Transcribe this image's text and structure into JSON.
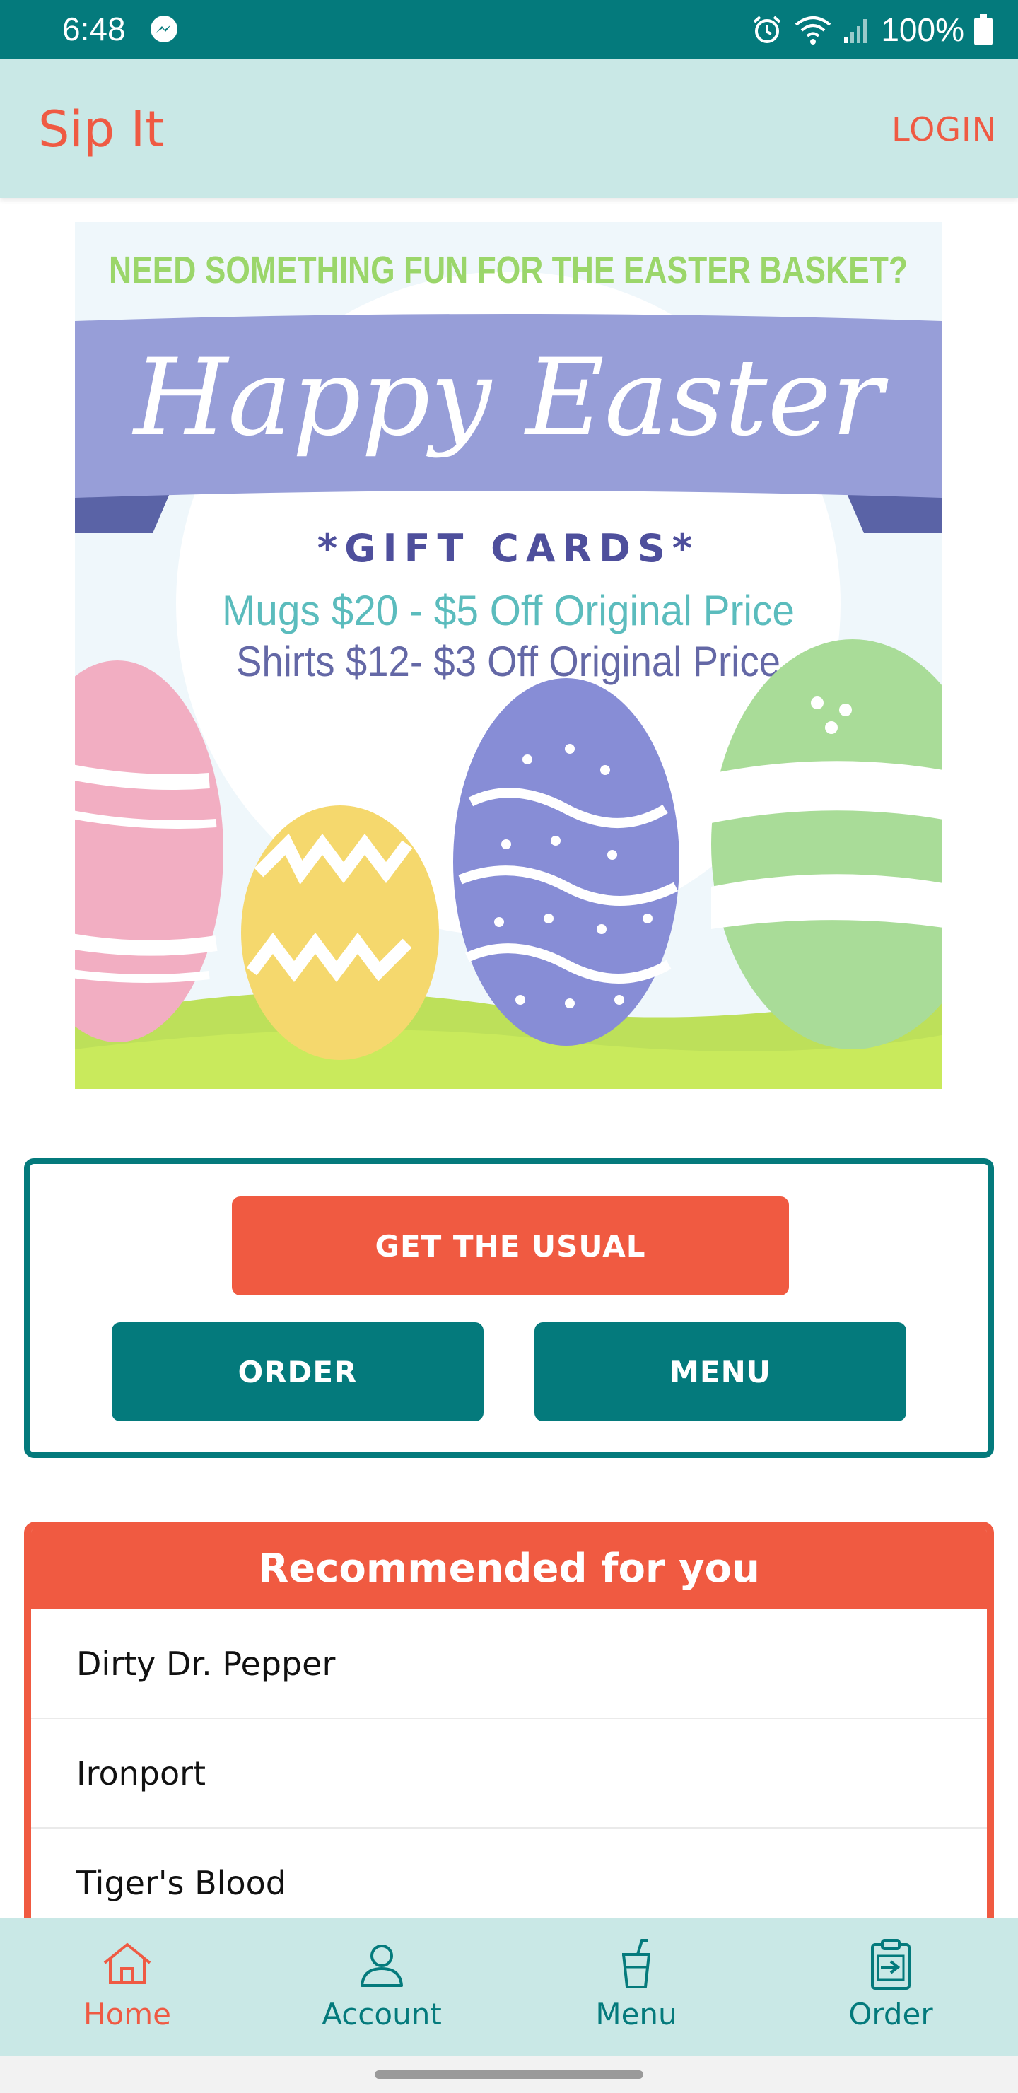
{
  "status_bar": {
    "time": "6:48",
    "battery": "100%"
  },
  "app_bar": {
    "title": "Sip It",
    "login": "LOGIN"
  },
  "banner": {
    "headline": "NEED SOMETHING FUN FOR THE EASTER BASKET?",
    "script_title": "Happy Easter",
    "gift_cards": "*GIFT CARDS*",
    "line1": "Mugs $20 - $5 Off Original Price",
    "line2": "Shirts $12- $3 Off Original Price"
  },
  "actions": {
    "usual": "GET THE USUAL",
    "order": "ORDER",
    "menu": "MENU"
  },
  "recommended": {
    "title": "Recommended for you",
    "items": [
      "Dirty Dr. Pepper",
      "Ironport",
      "Tiger's Blood"
    ]
  },
  "bottom_nav": {
    "items": [
      {
        "label": "Home",
        "icon": "home-icon",
        "active": true
      },
      {
        "label": "Account",
        "icon": "account-icon",
        "active": false
      },
      {
        "label": "Menu",
        "icon": "drink-cup-icon",
        "active": false
      },
      {
        "label": "Order",
        "icon": "clipboard-icon",
        "active": false
      }
    ]
  },
  "colors": {
    "teal": "#047a7c",
    "coral": "#f05a41",
    "mint": "#c9e8e6"
  }
}
